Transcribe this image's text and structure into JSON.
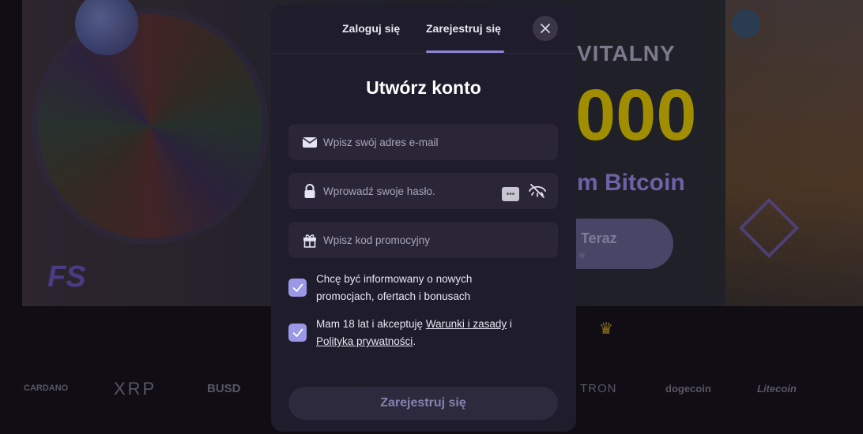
{
  "background": {
    "hero_line_1": "VITALNY",
    "hero_line_2": "000",
    "hero_line_3": "m Bitcoin",
    "hero_button_label": "Teraz",
    "hero_button_sub": "ię",
    "fs_badge": "FS",
    "crypto_logos": [
      "CARDANO",
      "XRP",
      "BUSD",
      "TRON",
      "dogecoin",
      "Litecoin"
    ]
  },
  "modal": {
    "tabs": [
      {
        "label": "Zaloguj się",
        "active": false
      },
      {
        "label": "Zarejestruj się",
        "active": true
      }
    ],
    "title": "Utwórz konto",
    "email": {
      "placeholder": "Wpisz swój adres e-mail",
      "value": "",
      "icon": "envelope-icon"
    },
    "password": {
      "placeholder": "Wprowadź swoje hasło.",
      "value": "",
      "icon": "lock-icon",
      "toggle_icon": "eye-off-icon"
    },
    "promo": {
      "placeholder": "Wpisz kod promocyjny",
      "value": "",
      "icon": "gift-icon"
    },
    "checkbox_news": {
      "checked": true,
      "line_1": "Chcę być informowany o nowych",
      "line_2": "promocjach, ofertach i bonusach"
    },
    "checkbox_terms": {
      "checked": true,
      "text_before": "Mam 18 lat i akceptuję ",
      "terms_link": "Warunki i zasady",
      "text_mid": " i",
      "privacy_link": "Polityka prywatności",
      "text_after": "."
    },
    "submit_label": "Zarejestruj się"
  },
  "colors": {
    "modal_bg": "#1f1c2b",
    "field_bg": "#2a2638",
    "accent": "#9c98e8",
    "hero_gold": "#c8b200"
  }
}
